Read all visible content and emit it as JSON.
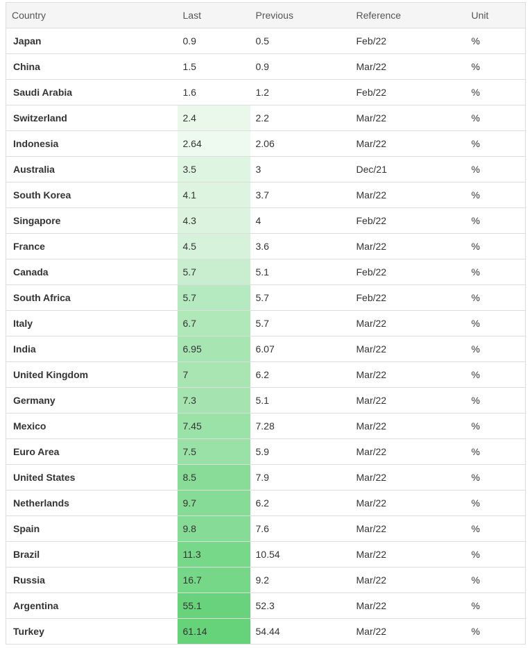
{
  "headers": [
    "Country",
    "Last",
    "Previous",
    "Reference",
    "Unit"
  ],
  "rows": [
    {
      "country": "Japan",
      "last": "0.9",
      "previous": "0.5",
      "reference": "Feb/22",
      "unit": "%",
      "last_bg": "#ffffff"
    },
    {
      "country": "China",
      "last": "1.5",
      "previous": "0.9",
      "reference": "Mar/22",
      "unit": "%",
      "last_bg": "#ffffff"
    },
    {
      "country": "Saudi Arabia",
      "last": "1.6",
      "previous": "1.2",
      "reference": "Feb/22",
      "unit": "%",
      "last_bg": "#ffffff"
    },
    {
      "country": "Switzerland",
      "last": "2.4",
      "previous": "2.2",
      "reference": "Mar/22",
      "unit": "%",
      "last_bg": "#eaf8ec"
    },
    {
      "country": "Indonesia",
      "last": "2.64",
      "previous": "2.06",
      "reference": "Mar/22",
      "unit": "%",
      "last_bg": "#eefaf0"
    },
    {
      "country": "Australia",
      "last": "3.5",
      "previous": "3",
      "reference": "Dec/21",
      "unit": "%",
      "last_bg": "#def5e2"
    },
    {
      "country": "South Korea",
      "last": "4.1",
      "previous": "3.7",
      "reference": "Mar/22",
      "unit": "%",
      "last_bg": "#dcf4e0"
    },
    {
      "country": "Singapore",
      "last": "4.3",
      "previous": "4",
      "reference": "Feb/22",
      "unit": "%",
      "last_bg": "#dbf3df"
    },
    {
      "country": "France",
      "last": "4.5",
      "previous": "3.6",
      "reference": "Mar/22",
      "unit": "%",
      "last_bg": "#d6f2db"
    },
    {
      "country": "Canada",
      "last": "5.7",
      "previous": "5.1",
      "reference": "Feb/22",
      "unit": "%",
      "last_bg": "#c9eecf"
    },
    {
      "country": "South Africa",
      "last": "5.7",
      "previous": "5.7",
      "reference": "Feb/22",
      "unit": "%",
      "last_bg": "#b5e9bf"
    },
    {
      "country": "Italy",
      "last": "6.7",
      "previous": "5.7",
      "reference": "Mar/22",
      "unit": "%",
      "last_bg": "#b0e8ba"
    },
    {
      "country": "India",
      "last": "6.95",
      "previous": "6.07",
      "reference": "Mar/22",
      "unit": "%",
      "last_bg": "#a7e5b2"
    },
    {
      "country": "United Kingdom",
      "last": "7",
      "previous": "6.2",
      "reference": "Mar/22",
      "unit": "%",
      "last_bg": "#a8e5b3"
    },
    {
      "country": "Germany",
      "last": "7.3",
      "previous": "5.1",
      "reference": "Mar/22",
      "unit": "%",
      "last_bg": "#a5e4b0"
    },
    {
      "country": "Mexico",
      "last": "7.45",
      "previous": "7.28",
      "reference": "Mar/22",
      "unit": "%",
      "last_bg": "#9be2a8"
    },
    {
      "country": "Euro Area",
      "last": "7.5",
      "previous": "5.9",
      "reference": "Mar/22",
      "unit": "%",
      "last_bg": "#9ae1a7"
    },
    {
      "country": "United States",
      "last": "8.5",
      "previous": "7.9",
      "reference": "Mar/22",
      "unit": "%",
      "last_bg": "#88dc97"
    },
    {
      "country": "Netherlands",
      "last": "9.7",
      "previous": "6.2",
      "reference": "Mar/22",
      "unit": "%",
      "last_bg": "#86dc96"
    },
    {
      "country": "Spain",
      "last": "9.8",
      "previous": "7.6",
      "reference": "Mar/22",
      "unit": "%",
      "last_bg": "#86dc96"
    },
    {
      "country": "Brazil",
      "last": "11.3",
      "previous": "10.54",
      "reference": "Mar/22",
      "unit": "%",
      "last_bg": "#78d88a"
    },
    {
      "country": "Russia",
      "last": "16.7",
      "previous": "9.2",
      "reference": "Mar/22",
      "unit": "%",
      "last_bg": "#76d788"
    },
    {
      "country": "Argentina",
      "last": "55.1",
      "previous": "52.3",
      "reference": "Mar/22",
      "unit": "%",
      "last_bg": "#68d37c"
    },
    {
      "country": "Turkey",
      "last": "61.14",
      "previous": "54.44",
      "reference": "Mar/22",
      "unit": "%",
      "last_bg": "#66d27a"
    }
  ]
}
